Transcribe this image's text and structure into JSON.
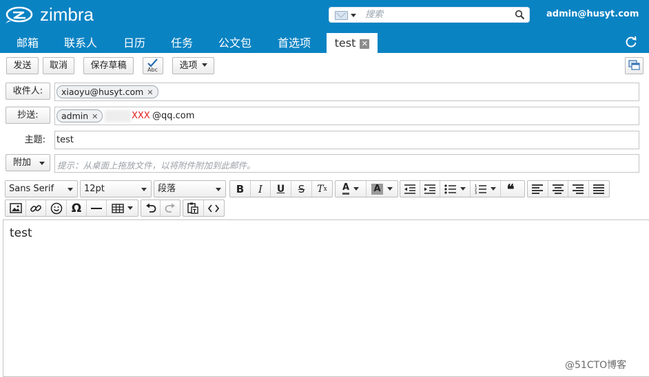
{
  "header": {
    "brand": "zimbra",
    "search_placeholder": "搜索",
    "search_type_icon": "mail-icon",
    "username": "admin@husyt.com"
  },
  "tabs": [
    {
      "label": "邮箱"
    },
    {
      "label": "联系人"
    },
    {
      "label": "日历"
    },
    {
      "label": "任务"
    },
    {
      "label": "公文包"
    },
    {
      "label": "首选项"
    },
    {
      "label": "test",
      "active": true
    }
  ],
  "toolbar": {
    "send": "发送",
    "cancel": "取消",
    "save_draft": "保存草稿",
    "options": "选项"
  },
  "compose": {
    "to_label": "收件人:",
    "to_recipients": [
      "xiaoyu@husyt.com"
    ],
    "cc_label": "抄送:",
    "cc_recipients": [
      "admin"
    ],
    "cc_masked": "XXX",
    "cc_typed_domain": "@qq.com",
    "subject_label": "主题:",
    "subject_value": "test",
    "attach_label": "附加",
    "attach_hint": "提示：从桌面上拖放文件，以将附件附加到此邮件。"
  },
  "editor": {
    "font_family": "Sans Serif",
    "font_size": "12pt",
    "block_format": "段落",
    "body_text": "test"
  },
  "colors": {
    "header_bg": "#0a83c3",
    "masked_text": "#e21b1b"
  },
  "watermark": "@51CTO博客"
}
